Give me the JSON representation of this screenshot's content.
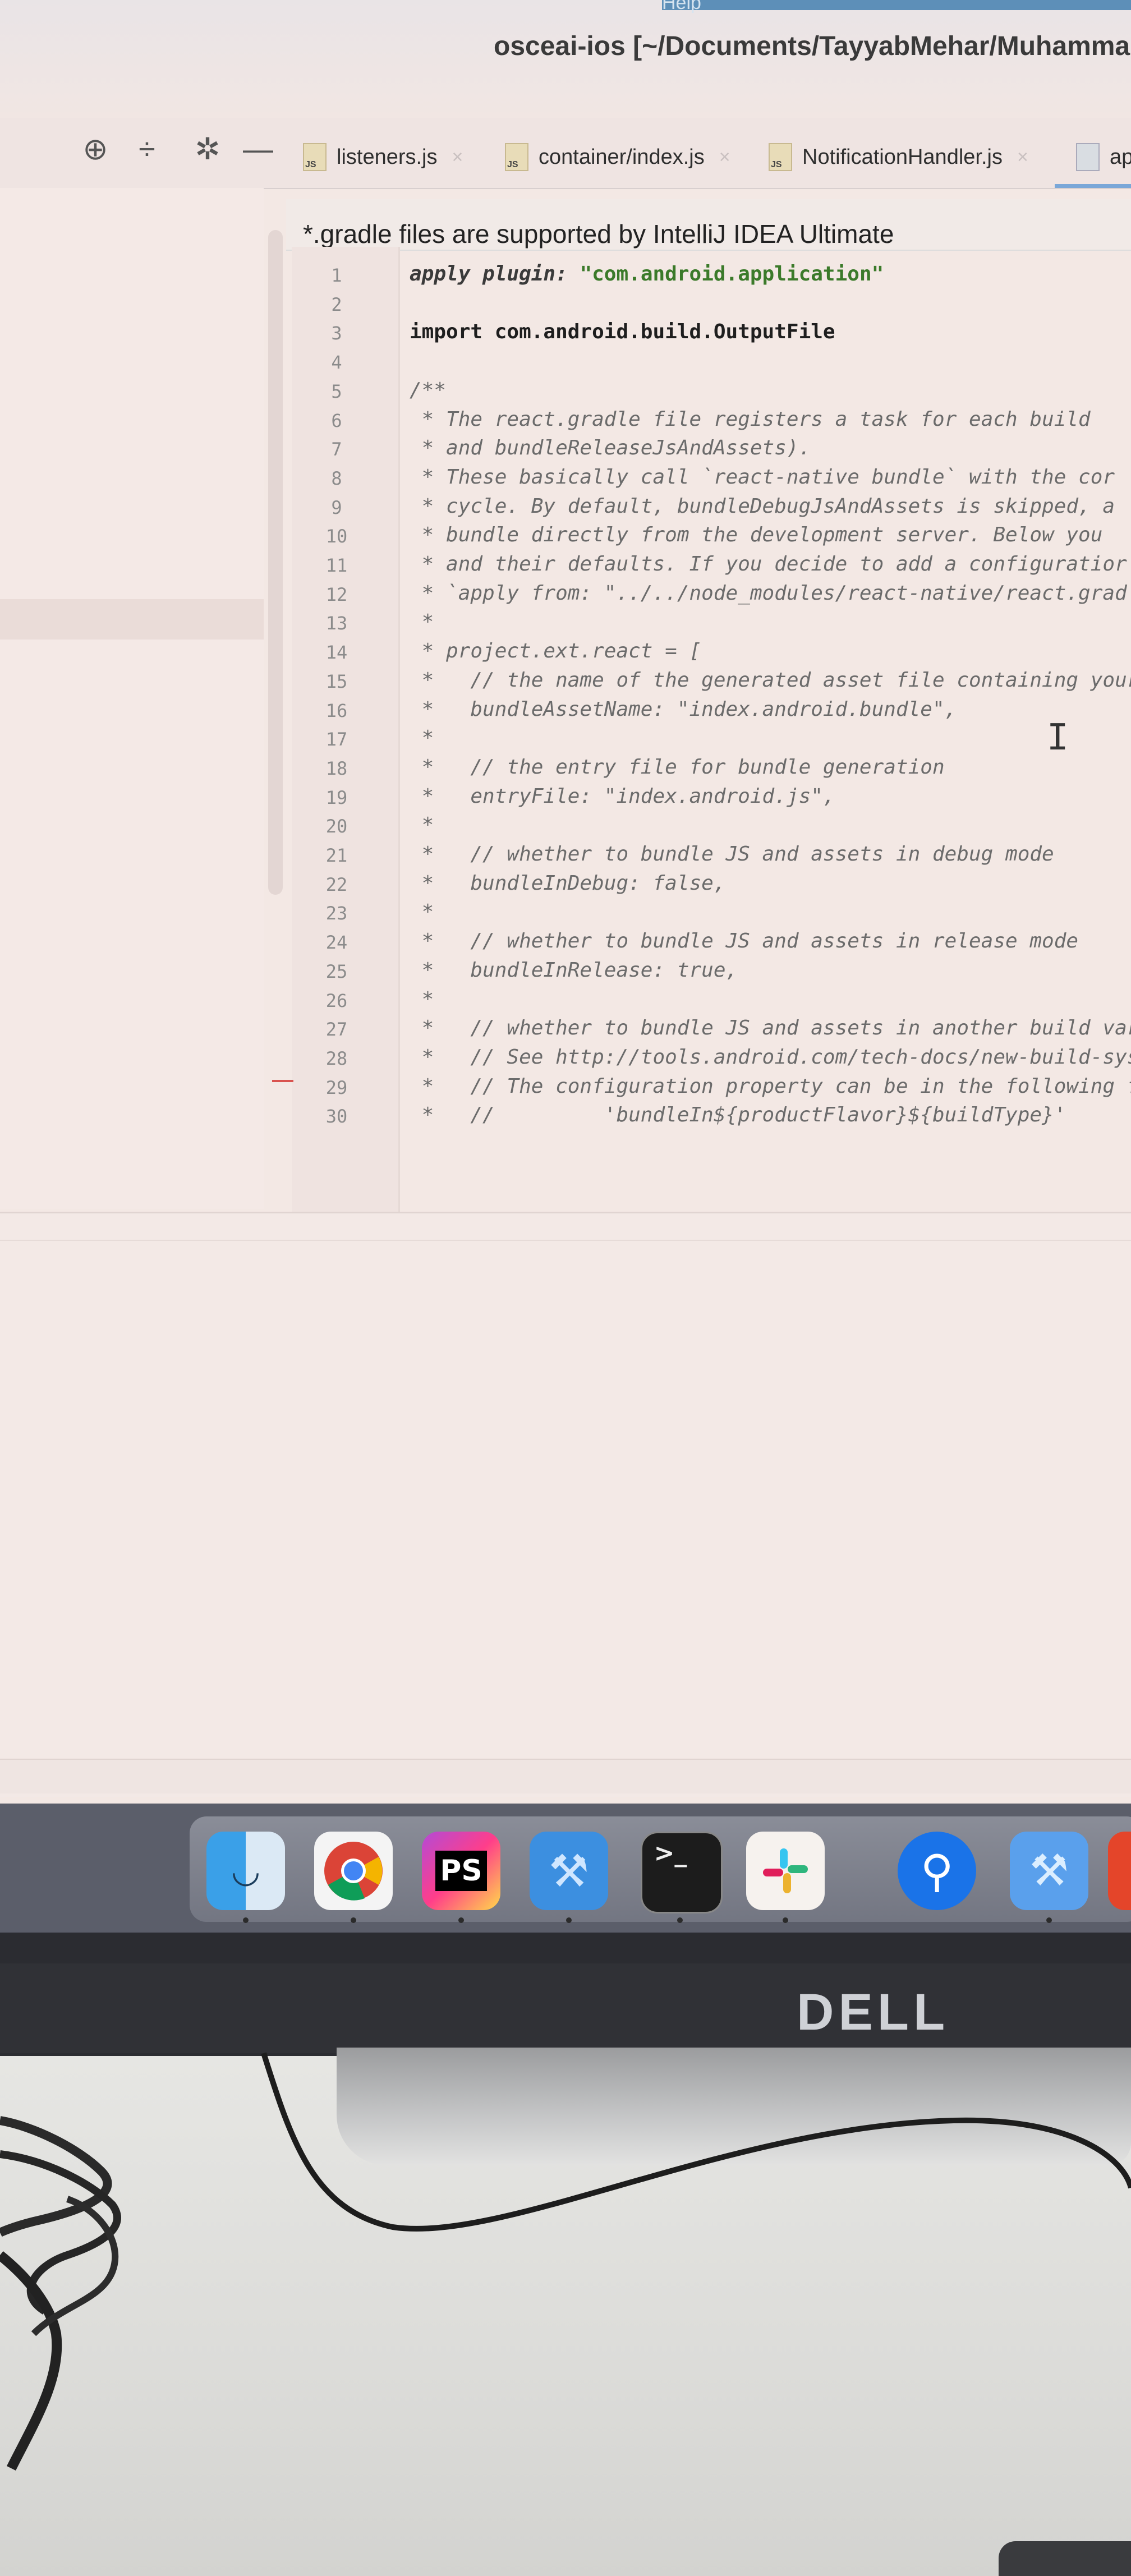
{
  "window": {
    "title": "osceai-ios [~/Documents/TayyabMehar/Muhamman",
    "menu_partial": "Help"
  },
  "toolbar": {
    "icons": [
      "crosshair-icon",
      "collapse-icon",
      "gear-icon",
      "minimize-icon"
    ]
  },
  "tabs": [
    {
      "label": "listeners.js",
      "icon": "js-file-icon"
    },
    {
      "label": "container/index.js",
      "icon": "js-file-icon"
    },
    {
      "label": "NotificationHandler.js",
      "icon": "js-file-icon"
    },
    {
      "label": "ap",
      "icon": "file-icon",
      "active": true
    }
  ],
  "banner": {
    "text": "*.gradle files are supported by IntelliJ IDEA Ultimate"
  },
  "editor": {
    "lines": [
      {
        "no": "1",
        "text": ""
      },
      {
        "no": "2",
        "text": ""
      },
      {
        "no": "3",
        "text": "import com.android.build.OutputFile"
      },
      {
        "no": "4",
        "text": ""
      },
      {
        "no": "5",
        "text": "/**"
      },
      {
        "no": "6",
        "text": " * The react.gradle file registers a task for each build"
      },
      {
        "no": "7",
        "text": " * and bundleReleaseJsAndAssets)."
      },
      {
        "no": "8",
        "text": " * These basically call `react-native bundle` with the cor"
      },
      {
        "no": "9",
        "text": " * cycle. By default, bundleDebugJsAndAssets is skipped, a"
      },
      {
        "no": "10",
        "text": " * bundle directly from the development server. Below you"
      },
      {
        "no": "11",
        "text": " * and their defaults. If you decide to add a configuratior"
      },
      {
        "no": "12",
        "text": " * `apply from: \"../../node_modules/react-native/react.grad"
      },
      {
        "no": "13",
        "text": " *"
      },
      {
        "no": "14",
        "text": " * project.ext.react = ["
      },
      {
        "no": "15",
        "text": " *   // the name of the generated asset file containing your"
      },
      {
        "no": "16",
        "text": " *   bundleAssetName: \"index.android.bundle\","
      },
      {
        "no": "17",
        "text": " *"
      },
      {
        "no": "18",
        "text": " *   // the entry file for bundle generation"
      },
      {
        "no": "19",
        "text": " *   entryFile: \"index.android.js\","
      },
      {
        "no": "20",
        "text": " *"
      },
      {
        "no": "21",
        "text": " *   // whether to bundle JS and assets in debug mode"
      },
      {
        "no": "22",
        "text": " *   bundleInDebug: false,"
      },
      {
        "no": "23",
        "text": " *"
      },
      {
        "no": "24",
        "text": " *   // whether to bundle JS and assets in release mode"
      },
      {
        "no": "25",
        "text": " *   bundleInRelease: true,"
      },
      {
        "no": "26",
        "text": " *"
      },
      {
        "no": "27",
        "text": " *   // whether to bundle JS and assets in another build variant"
      },
      {
        "no": "28",
        "text": " *   // See http://tools.android.com/tech-docs/new-build-system/"
      },
      {
        "no": "29",
        "text": " *   // The configuration property can be in the following forma"
      },
      {
        "no": "30",
        "text": " *   //         'bundleIn${productFlavor}${buildType}'"
      }
    ],
    "line1_keyword": "apply plugin:",
    "line1_string": "\"com.android.application\""
  },
  "dock": {
    "apps": [
      {
        "name": "Finder",
        "icon": "finder-icon"
      },
      {
        "name": "Chrome",
        "icon": "chrome-icon"
      },
      {
        "name": "PS",
        "icon": "phpstorm-icon"
      },
      {
        "name": "Xcode",
        "icon": "xcode-icon"
      },
      {
        "name": "Terminal",
        "icon": "terminal-icon"
      },
      {
        "name": "Slack",
        "icon": "slack-icon"
      },
      {
        "name": "Maps",
        "icon": "location-icon"
      },
      {
        "name": "Simulator",
        "icon": "simulator-icon"
      }
    ],
    "ps_label": "PS",
    "terminal_label": ">_"
  },
  "monitor": {
    "brand": "DELL"
  }
}
